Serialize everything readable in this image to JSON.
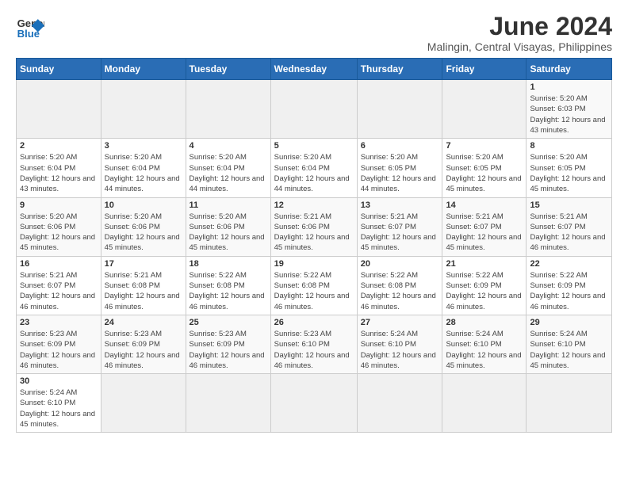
{
  "logo": {
    "text_general": "General",
    "text_blue": "Blue"
  },
  "title": "June 2024",
  "subtitle": "Malingin, Central Visayas, Philippines",
  "headers": [
    "Sunday",
    "Monday",
    "Tuesday",
    "Wednesday",
    "Thursday",
    "Friday",
    "Saturday"
  ],
  "days": [
    {
      "week": 1,
      "cells": [
        {
          "day": "",
          "empty": true
        },
        {
          "day": "",
          "empty": true
        },
        {
          "day": "",
          "empty": true
        },
        {
          "day": "",
          "empty": true
        },
        {
          "day": "",
          "empty": true
        },
        {
          "day": "",
          "empty": true
        },
        {
          "day": "1",
          "sunrise": "Sunrise: 5:20 AM",
          "sunset": "Sunset: 6:03 PM",
          "daylight": "Daylight: 12 hours and 43 minutes."
        }
      ]
    },
    {
      "week": 2,
      "cells": [
        {
          "day": "2",
          "sunrise": "Sunrise: 5:20 AM",
          "sunset": "Sunset: 6:04 PM",
          "daylight": "Daylight: 12 hours and 43 minutes."
        },
        {
          "day": "3",
          "sunrise": "Sunrise: 5:20 AM",
          "sunset": "Sunset: 6:04 PM",
          "daylight": "Daylight: 12 hours and 44 minutes."
        },
        {
          "day": "4",
          "sunrise": "Sunrise: 5:20 AM",
          "sunset": "Sunset: 6:04 PM",
          "daylight": "Daylight: 12 hours and 44 minutes."
        },
        {
          "day": "5",
          "sunrise": "Sunrise: 5:20 AM",
          "sunset": "Sunset: 6:04 PM",
          "daylight": "Daylight: 12 hours and 44 minutes."
        },
        {
          "day": "6",
          "sunrise": "Sunrise: 5:20 AM",
          "sunset": "Sunset: 6:05 PM",
          "daylight": "Daylight: 12 hours and 44 minutes."
        },
        {
          "day": "7",
          "sunrise": "Sunrise: 5:20 AM",
          "sunset": "Sunset: 6:05 PM",
          "daylight": "Daylight: 12 hours and 45 minutes."
        },
        {
          "day": "8",
          "sunrise": "Sunrise: 5:20 AM",
          "sunset": "Sunset: 6:05 PM",
          "daylight": "Daylight: 12 hours and 45 minutes."
        }
      ]
    },
    {
      "week": 3,
      "cells": [
        {
          "day": "9",
          "sunrise": "Sunrise: 5:20 AM",
          "sunset": "Sunset: 6:06 PM",
          "daylight": "Daylight: 12 hours and 45 minutes."
        },
        {
          "day": "10",
          "sunrise": "Sunrise: 5:20 AM",
          "sunset": "Sunset: 6:06 PM",
          "daylight": "Daylight: 12 hours and 45 minutes."
        },
        {
          "day": "11",
          "sunrise": "Sunrise: 5:20 AM",
          "sunset": "Sunset: 6:06 PM",
          "daylight": "Daylight: 12 hours and 45 minutes."
        },
        {
          "day": "12",
          "sunrise": "Sunrise: 5:21 AM",
          "sunset": "Sunset: 6:06 PM",
          "daylight": "Daylight: 12 hours and 45 minutes."
        },
        {
          "day": "13",
          "sunrise": "Sunrise: 5:21 AM",
          "sunset": "Sunset: 6:07 PM",
          "daylight": "Daylight: 12 hours and 45 minutes."
        },
        {
          "day": "14",
          "sunrise": "Sunrise: 5:21 AM",
          "sunset": "Sunset: 6:07 PM",
          "daylight": "Daylight: 12 hours and 45 minutes."
        },
        {
          "day": "15",
          "sunrise": "Sunrise: 5:21 AM",
          "sunset": "Sunset: 6:07 PM",
          "daylight": "Daylight: 12 hours and 46 minutes."
        }
      ]
    },
    {
      "week": 4,
      "cells": [
        {
          "day": "16",
          "sunrise": "Sunrise: 5:21 AM",
          "sunset": "Sunset: 6:07 PM",
          "daylight": "Daylight: 12 hours and 46 minutes."
        },
        {
          "day": "17",
          "sunrise": "Sunrise: 5:21 AM",
          "sunset": "Sunset: 6:08 PM",
          "daylight": "Daylight: 12 hours and 46 minutes."
        },
        {
          "day": "18",
          "sunrise": "Sunrise: 5:22 AM",
          "sunset": "Sunset: 6:08 PM",
          "daylight": "Daylight: 12 hours and 46 minutes."
        },
        {
          "day": "19",
          "sunrise": "Sunrise: 5:22 AM",
          "sunset": "Sunset: 6:08 PM",
          "daylight": "Daylight: 12 hours and 46 minutes."
        },
        {
          "day": "20",
          "sunrise": "Sunrise: 5:22 AM",
          "sunset": "Sunset: 6:08 PM",
          "daylight": "Daylight: 12 hours and 46 minutes."
        },
        {
          "day": "21",
          "sunrise": "Sunrise: 5:22 AM",
          "sunset": "Sunset: 6:09 PM",
          "daylight": "Daylight: 12 hours and 46 minutes."
        },
        {
          "day": "22",
          "sunrise": "Sunrise: 5:22 AM",
          "sunset": "Sunset: 6:09 PM",
          "daylight": "Daylight: 12 hours and 46 minutes."
        }
      ]
    },
    {
      "week": 5,
      "cells": [
        {
          "day": "23",
          "sunrise": "Sunrise: 5:23 AM",
          "sunset": "Sunset: 6:09 PM",
          "daylight": "Daylight: 12 hours and 46 minutes."
        },
        {
          "day": "24",
          "sunrise": "Sunrise: 5:23 AM",
          "sunset": "Sunset: 6:09 PM",
          "daylight": "Daylight: 12 hours and 46 minutes."
        },
        {
          "day": "25",
          "sunrise": "Sunrise: 5:23 AM",
          "sunset": "Sunset: 6:09 PM",
          "daylight": "Daylight: 12 hours and 46 minutes."
        },
        {
          "day": "26",
          "sunrise": "Sunrise: 5:23 AM",
          "sunset": "Sunset: 6:10 PM",
          "daylight": "Daylight: 12 hours and 46 minutes."
        },
        {
          "day": "27",
          "sunrise": "Sunrise: 5:24 AM",
          "sunset": "Sunset: 6:10 PM",
          "daylight": "Daylight: 12 hours and 46 minutes."
        },
        {
          "day": "28",
          "sunrise": "Sunrise: 5:24 AM",
          "sunset": "Sunset: 6:10 PM",
          "daylight": "Daylight: 12 hours and 45 minutes."
        },
        {
          "day": "29",
          "sunrise": "Sunrise: 5:24 AM",
          "sunset": "Sunset: 6:10 PM",
          "daylight": "Daylight: 12 hours and 45 minutes."
        }
      ]
    },
    {
      "week": 6,
      "cells": [
        {
          "day": "30",
          "sunrise": "Sunrise: 5:24 AM",
          "sunset": "Sunset: 6:10 PM",
          "daylight": "Daylight: 12 hours and 45 minutes."
        },
        {
          "day": "",
          "empty": true
        },
        {
          "day": "",
          "empty": true
        },
        {
          "day": "",
          "empty": true
        },
        {
          "day": "",
          "empty": true
        },
        {
          "day": "",
          "empty": true
        },
        {
          "day": "",
          "empty": true
        }
      ]
    }
  ]
}
